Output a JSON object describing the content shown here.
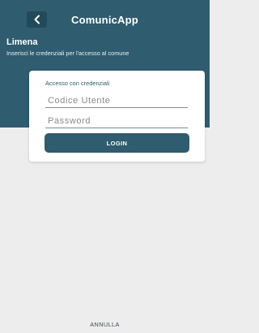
{
  "app": {
    "title": "ComunicApp",
    "back_icon": "chevron-left-icon"
  },
  "location": {
    "town": "Limena",
    "instruction": "Inserisci le credenziali per l'accesso al comune"
  },
  "login_card": {
    "title": "Accesso con credenziali",
    "user_code_placeholder": "Codice Utente",
    "user_code_value": "",
    "password_placeholder": "Password",
    "password_value": "",
    "login_label": "LOGIN"
  },
  "footer": {
    "cancel_label": "ANNULLA"
  },
  "colors": {
    "primary": "#2f5c6e",
    "background": "#ededed",
    "card": "#ffffff"
  }
}
